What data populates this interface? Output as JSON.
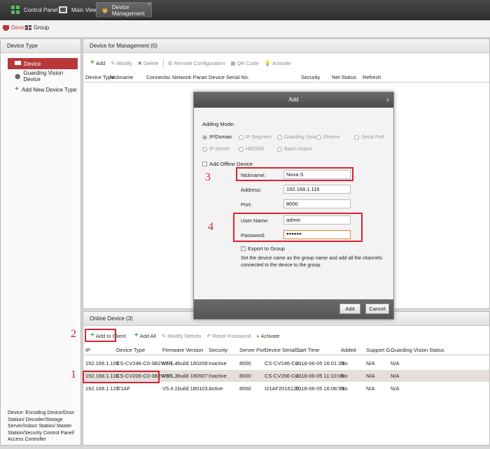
{
  "top_tabs": [
    {
      "label": "Control Panel",
      "icon": "grid-icon"
    },
    {
      "label": "Main View",
      "icon": "film-icon"
    },
    {
      "label": "Device Management",
      "icon": "device-icon",
      "active": true
    }
  ],
  "sub_tabs": [
    {
      "label": "Device",
      "active": true
    },
    {
      "label": "Group"
    }
  ],
  "left_panel": {
    "title": "Device Type",
    "items": [
      "Device",
      "Guarding Vision Device",
      "Add New Device Type"
    ],
    "note": "Device: Encoding Device/Door Station/ Decoder/Storage Server/Indoor Station/ Master Station/Security Control Panel/ Access Controller"
  },
  "mgmt": {
    "title": "Device for Management (0)",
    "toolbar": [
      "Add",
      "Modify",
      "Delete",
      "Remote Configuration",
      "QR Code",
      "Activate"
    ],
    "columns": [
      "Device Type",
      "Nickname",
      "Connectio...",
      "Network Paramet...",
      "Device Serial No.",
      "Security",
      "Net Status",
      "Refresh"
    ]
  },
  "online": {
    "title": "Online Device (3)",
    "toolbar": [
      "Add to Client",
      "Add All",
      "Modify Netinfo",
      "Reset Password",
      "Activate"
    ],
    "columns": [
      "IP",
      "Device Type",
      "Firmware Version",
      "Security",
      "Server Port",
      "Device Serial ...",
      "Start Time",
      "Added",
      "Support G...",
      "Guarding Vision Status"
    ],
    "rows": [
      [
        "192.168.1.103",
        "CS-CV246-C0-3B2WFR...",
        "V5.1.4build 180208",
        "Inactive",
        "8000",
        "CS-CV246-C0-...",
        "2018-06-05 16:01:23",
        "No",
        "N/A",
        "N/A"
      ],
      [
        "192.168.1.116",
        "CS-CV206-C0-3B2W2F...",
        "V5.1.3build 180507",
        "Inactive",
        "8000",
        "CS-CV206-C0-...",
        "2018-06-05 11:10:08",
        "No",
        "N/A",
        "N/A"
      ],
      [
        "192.168.1.127",
        "I21AF",
        "V5.4.1build 180103",
        "Active",
        "8000",
        "I21AF2016120...",
        "2018-06-05 16:08:53",
        "No",
        "N/A",
        "N/A"
      ]
    ]
  },
  "dialog": {
    "title": "Add",
    "close": "x",
    "adding_mode_label": "Adding Mode:",
    "modes_row1": [
      "IP/Domain",
      "IP Segment",
      "Guarding Visio...",
      "EHome",
      "Serial Port"
    ],
    "modes_row2": [
      "IP Server",
      "HiDDNS",
      "Batch Import"
    ],
    "offline_label": "Add Offline Device",
    "nickname_label": "Nickname:",
    "nickname_value": "Nova S",
    "address_label": "Address:",
    "address_value": "192.168.1.116",
    "port_label": "Port:",
    "port_value": "8000",
    "username_label": "User Name:",
    "username_value": "admin",
    "password_label": "Password:",
    "password_value": "●●●●●●",
    "export_label": "Export to Group",
    "export_desc": "Set the device name as the group name and add all the channels connected to the device to the group.",
    "add_button": "Add",
    "cancel_button": "Cancel"
  },
  "annotations": [
    "1",
    "2",
    "3",
    "4"
  ],
  "colors": {
    "accent_red": "#b8383a",
    "annotation_red": "#d9232f",
    "add_green": "#3aa33a"
  }
}
